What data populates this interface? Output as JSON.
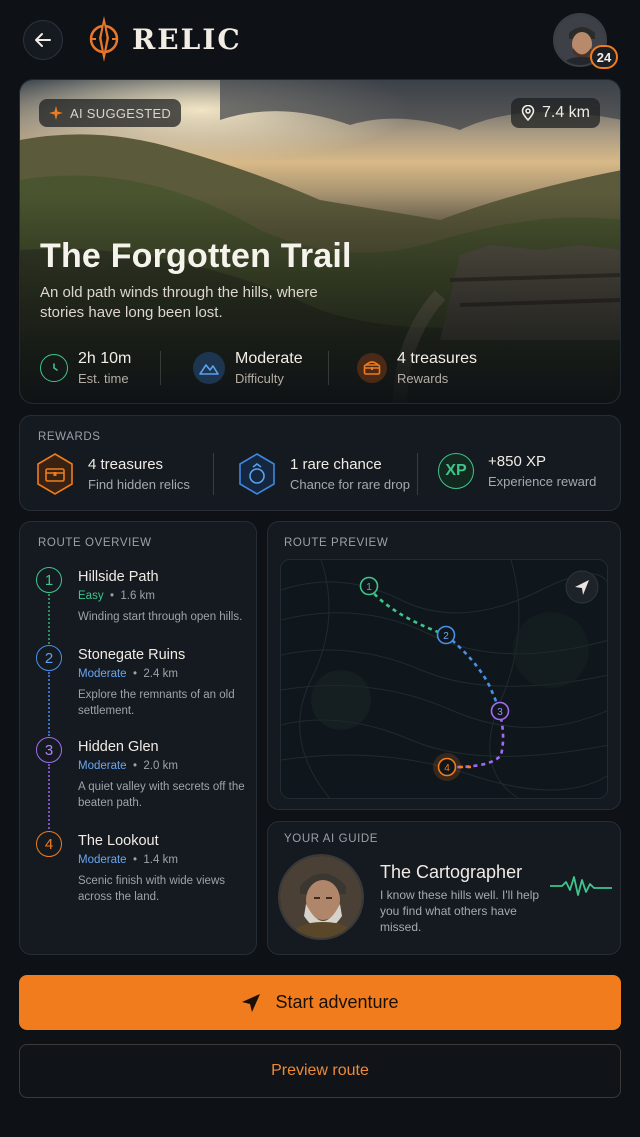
{
  "header": {
    "brand": "RELIC",
    "user_level": "24"
  },
  "hero": {
    "badge": "AI SUGGESTED",
    "distance": "7.4 km",
    "title": "The Forgotten Trail",
    "subtitle": "An old path winds through the hills, where stories have long been lost.",
    "stats": [
      {
        "value": "2h 10m",
        "label": "Est. time",
        "icon": "clock-icon"
      },
      {
        "value": "Moderate",
        "label": "Difficulty",
        "icon": "mountain-icon"
      },
      {
        "value": "4 treasures",
        "label": "Rewards",
        "icon": "chest-icon"
      }
    ]
  },
  "rewards": {
    "heading": "REWARDS",
    "items": [
      {
        "title": "4 treasures",
        "subtitle": "Find hidden relics",
        "icon": "chest-icon",
        "color": "#f07c1e"
      },
      {
        "title": "1 rare chance",
        "subtitle": "Chance for rare drop",
        "icon": "gem-icon",
        "color": "#3f86e0"
      },
      {
        "title": "+850 XP",
        "subtitle": "Experience reward",
        "icon": "xp-icon",
        "color": "#3fc48a",
        "icon_text": "XP"
      }
    ]
  },
  "route_overview": {
    "heading": "ROUTE OVERVIEW",
    "steps": [
      {
        "num": "1",
        "title": "Hillside Path",
        "difficulty": "Easy",
        "distance": "1.6 km",
        "description": "Winding start through open hills.",
        "color": "#3fc48a"
      },
      {
        "num": "2",
        "title": "Stonegate Ruins",
        "difficulty": "Moderate",
        "distance": "2.4 km",
        "description": "Explore the remnants of an old settlement.",
        "color": "#4a8fe8"
      },
      {
        "num": "3",
        "title": "Hidden Glen",
        "difficulty": "Moderate",
        "distance": "2.0 km",
        "description": "A quiet valley with secrets off the beaten path.",
        "color": "#a36bf0"
      },
      {
        "num": "4",
        "title": "The Lookout",
        "difficulty": "Moderate",
        "distance": "1.4 km",
        "description": "Scenic finish with wide views across the land.",
        "color": "#f07c1e"
      }
    ]
  },
  "route_preview": {
    "heading": "ROUTE PREVIEW",
    "markers": [
      "1",
      "2",
      "3",
      "4"
    ]
  },
  "guide": {
    "heading": "YOUR AI GUIDE",
    "name": "The Cartographer",
    "message": "I know these hills well. I'll help you find what others have missed."
  },
  "actions": {
    "primary": "Start adventure",
    "secondary": "Preview route"
  },
  "colors": {
    "accent": "#f07c1e",
    "background": "#0e1217",
    "panel": "#141a20"
  }
}
